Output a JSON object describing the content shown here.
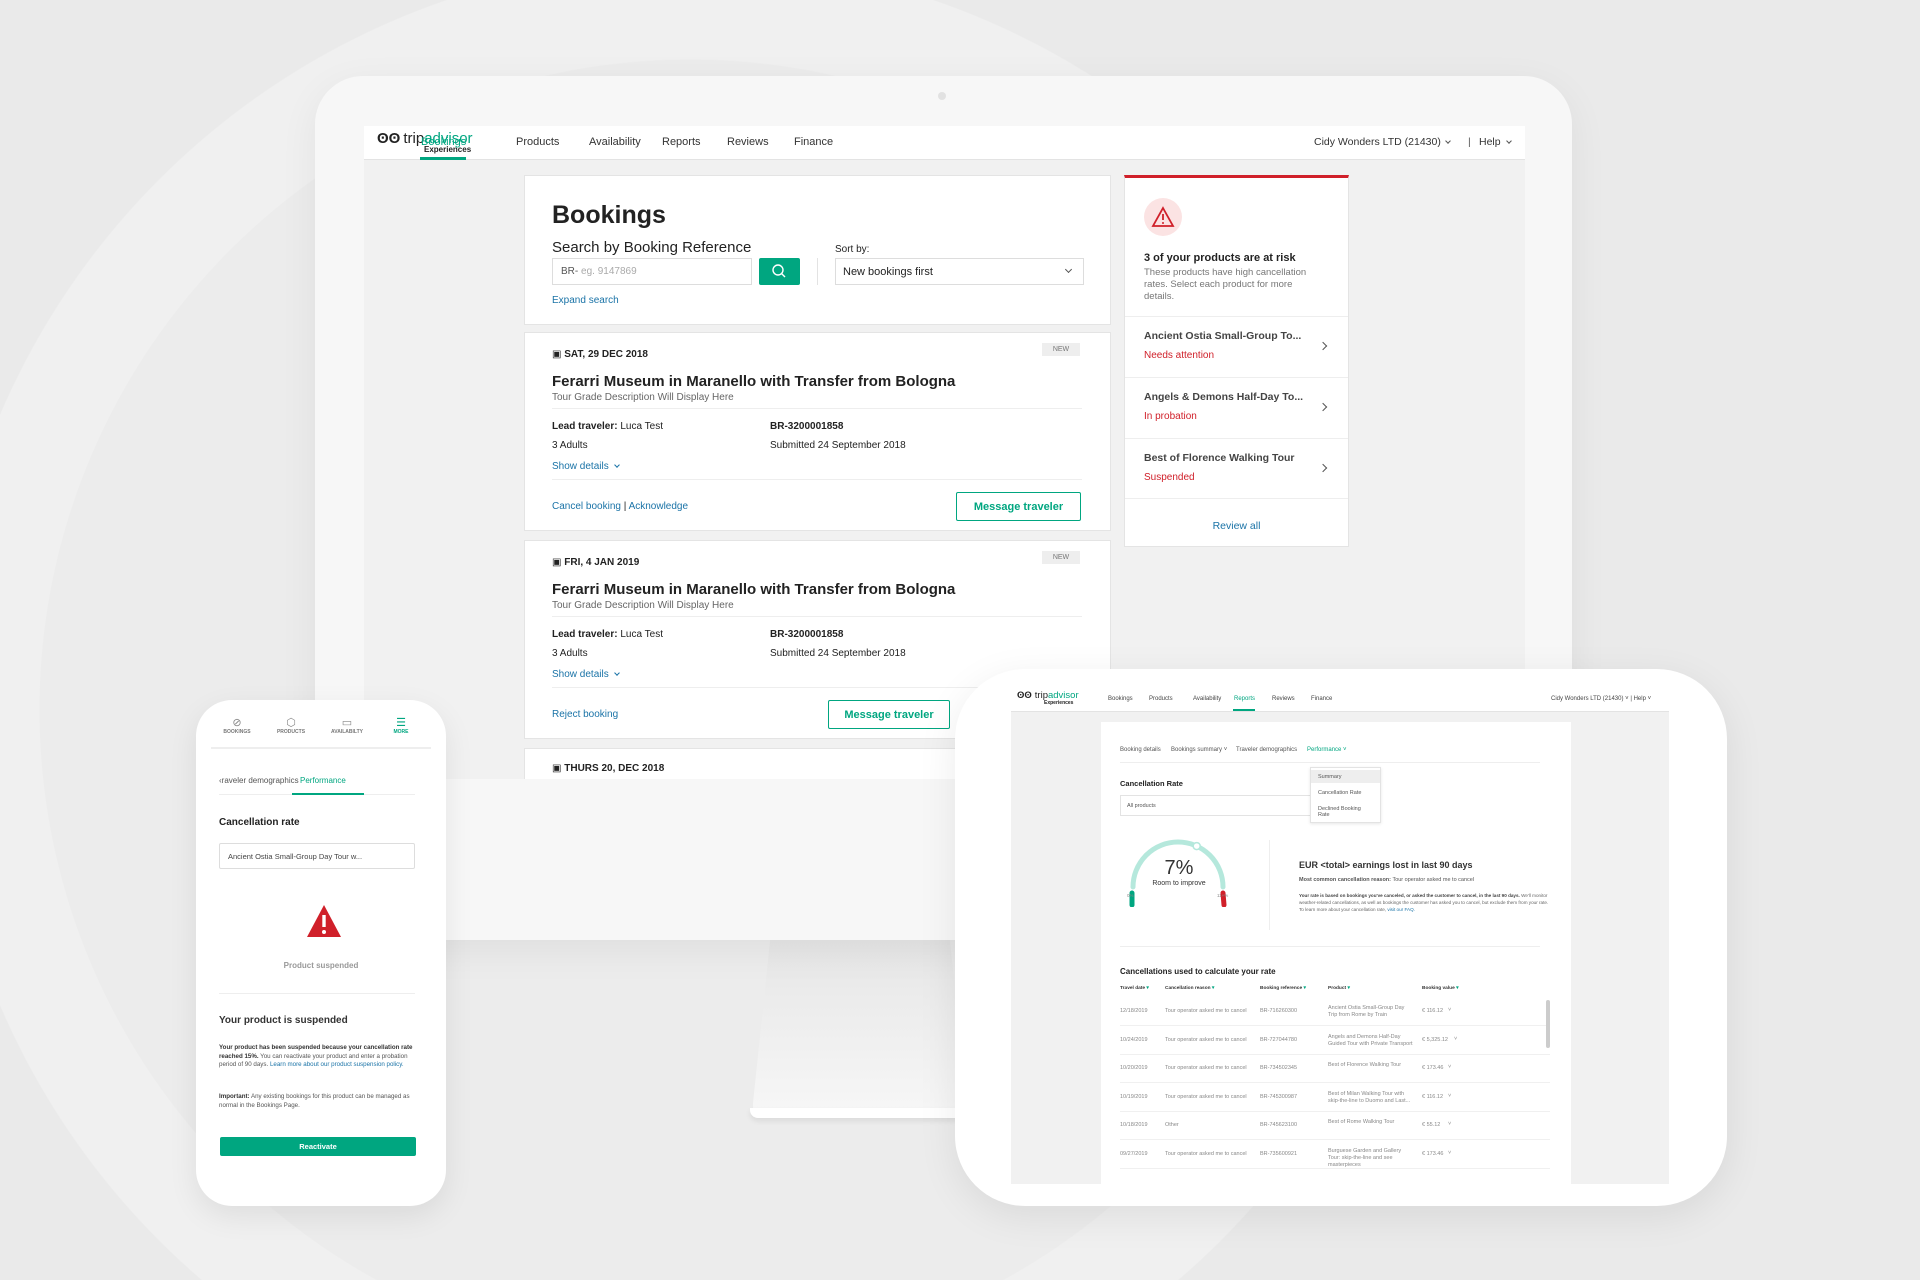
{
  "colors": {
    "brand": "#00a680",
    "danger": "#d0202a",
    "link": "#1a73a7"
  },
  "desktop": {
    "logo": {
      "text1": "trip",
      "text2": "advisor",
      "sub": "Experiences"
    },
    "nav": [
      "Bookings",
      "Products",
      "Availability",
      "Reports",
      "Reviews",
      "Finance"
    ],
    "active_nav": "Bookings",
    "account": "Cidy Wonders LTD (21430)",
    "help": "Help",
    "bookings": {
      "title": "Bookings",
      "search_label": "Search by Booking Reference",
      "search_prefix": "BR-",
      "search_placeholder": "eg. 9147869",
      "sort_label": "Sort by:",
      "sort_value": "New bookings first",
      "expand": "Expand search"
    },
    "cards": [
      {
        "date": "SAT, 29 DEC 2018",
        "badge": "NEW",
        "title": "Ferarri Museum in Maranello with Transfer from Bologna",
        "desc": "Tour Grade Description Will Display Here",
        "lead_label": "Lead traveler:",
        "lead": "Luca Test",
        "ref": "BR-3200001858",
        "pax": "3 Adults",
        "submitted": "Submitted 24 September 2018",
        "details": "Show details",
        "action1": "Cancel booking",
        "sep": "|",
        "action2": "Acknowledge",
        "message": "Message traveler"
      },
      {
        "date": "FRI, 4 JAN 2019",
        "badge": "NEW",
        "title": "Ferarri Museum in Maranello with Transfer from Bologna",
        "desc": "Tour Grade Description Will Display Here",
        "lead_label": "Lead traveler:",
        "lead": "Luca Test",
        "ref": "BR-3200001858",
        "pax": "3 Adults",
        "submitted": "Submitted 24 September 2018",
        "details": "Show details",
        "action1": "Reject booking",
        "message": "Message traveler"
      },
      {
        "date": "THURS 20, DEC 2018"
      }
    ],
    "risk": {
      "title": "3 of your products are at risk",
      "desc": "These products have high cancellation rates. Select each product for more details.",
      "items": [
        {
          "name": "Ancient Ostia Small-Group To...",
          "status": "Needs attention"
        },
        {
          "name": "Angels & Demons Half-Day To...",
          "status": "In probation"
        },
        {
          "name": "Best of Florence Walking Tour",
          "status": "Suspended"
        }
      ],
      "review_all": "Review all"
    }
  },
  "tablet": {
    "nav": [
      "Bookings",
      "Products",
      "Availability",
      "Reports",
      "Reviews",
      "Finance"
    ],
    "active_nav": "Reports",
    "account": "Cidy Wonders LTD (21430)",
    "help": "Help",
    "subtabs": [
      "Booking details",
      "Bookings summary",
      "Traveler demographics",
      "Performance"
    ],
    "dropdown": [
      "Summary",
      "Cancellation Rate",
      "Declined Booking Rate"
    ],
    "section": "Cancellation Rate",
    "filter": "All products",
    "gauge": {
      "value": "7%",
      "value_pct": 7,
      "label": "Room to improve",
      "min": "0%",
      "max": "11+%"
    },
    "earnings": "EUR <total> earnings lost in last 90 days",
    "reason_label": "Most common cancellation reason:",
    "reason": "Tour operator asked me to cancel",
    "note_bold": "Your rate is based on bookings you've canceled, or asked the customer to cancel, in the last 90 days.",
    "note": "We'll monitor weather-related cancellations, as well as bookings the customer has asked you to cancel, but exclude them from your rate. To learn more about your cancellation rate,",
    "note_link": "visit our FAQ.",
    "table_title": "Cancellations used to calculate your rate",
    "columns": [
      "Travel date",
      "Cancellation reason",
      "Booking reference",
      "Product",
      "Booking value"
    ],
    "rows": [
      [
        "12/18/2019",
        "Tour operator asked me to cancel",
        "BR-716260300",
        "Ancient Ostia Small-Group Day Trip from Rome by Train",
        "€ 116.12"
      ],
      [
        "10/24/2019",
        "Tour operator asked me to cancel",
        "BR-727044780",
        "Angels and Demons Half-Day Guided Tour with Private Transport",
        "€ 5,325.12"
      ],
      [
        "10/20/2019",
        "Tour operator asked me to cancel",
        "BR-734502345",
        "Best of Florence Walking Tour",
        "€ 173.46"
      ],
      [
        "10/19/2019",
        "Tour operator asked me to cancel",
        "BR-745300987",
        "Best of Milan Walking Tour with skip-the-line to Duomo and Last...",
        "€ 116.12"
      ],
      [
        "10/18/2019",
        "Other",
        "BR-745623100",
        "Best of Rome Walking Tour",
        "€ 55.12"
      ],
      [
        "09/27/2019",
        "Tour operator asked me to cancel",
        "BR-735600921",
        "Burguese Garden and Gallery Tour: skip-the-line and see masterpieces",
        "€ 173.46"
      ]
    ]
  },
  "phone": {
    "tabs": [
      "BOOKINGS",
      "PRODUCTS",
      "AVAILABILTY",
      "MORE"
    ],
    "subtab_prev": "raveler demographics",
    "subtab_active": "Performance",
    "section": "Cancellation rate",
    "select": "Ancient Ostia Small-Group Day Tour w...",
    "status": "Product suspended",
    "heading": "Your product is suspended",
    "body_bold": "Your product has been suspended because your cancellation rate reached 15%.",
    "body": "You can reactivate your product and enter a probation period of 90 days.",
    "body_link": "Learn more about our product suspension policy.",
    "important_label": "Important:",
    "important": "Any existing bookings for this product can be managed as normal in the Bookings Page.",
    "button": "Reactivate"
  }
}
